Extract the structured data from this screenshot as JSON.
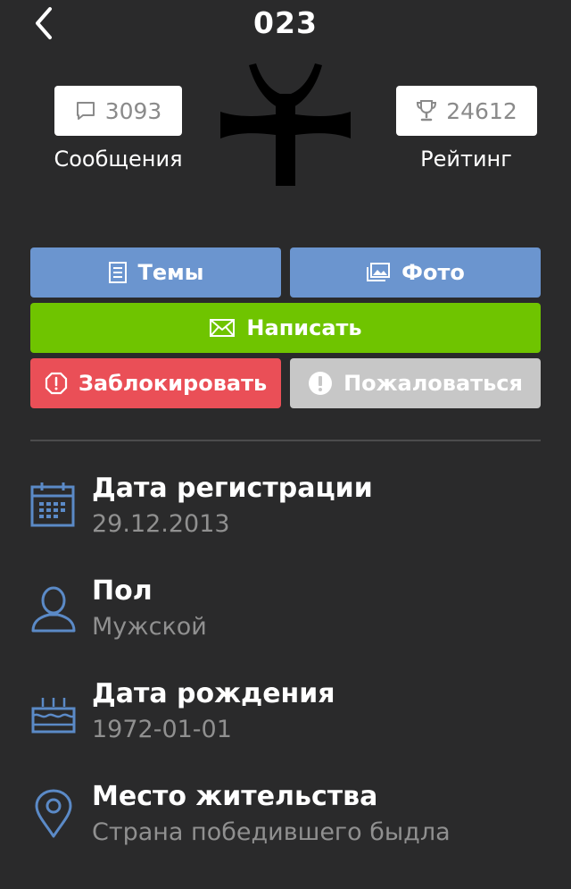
{
  "header": {
    "title": "023"
  },
  "stats": {
    "messages": {
      "count": "3093",
      "label": "Сообщения",
      "icon": "speech-bubble-icon"
    },
    "rating": {
      "count": "24612",
      "label": "Рейтинг",
      "icon": "trophy-icon"
    }
  },
  "actions": {
    "topics": "Темы",
    "photo": "Фото",
    "write": "Написать",
    "block": "Заблокировать",
    "report": "Пожаловаться"
  },
  "info": {
    "registration": {
      "title": "Дата регистрации",
      "value": "29.12.2013",
      "icon": "calendar-icon"
    },
    "gender": {
      "title": "Пол",
      "value": "Мужской",
      "icon": "user-icon"
    },
    "birthday": {
      "title": "Дата рождения",
      "value": "1972-01-01",
      "icon": "cake-icon"
    },
    "location": {
      "title": "Место жительства",
      "value": "Страна победившего быдла",
      "icon": "location-pin-icon"
    }
  },
  "colors": {
    "background": "#2a2a2b",
    "blue": "#6b95cf",
    "green": "#6fc400",
    "red": "#ea4f57",
    "grey": "#c7c7c7",
    "icon_blue": "#5b8ac7"
  }
}
